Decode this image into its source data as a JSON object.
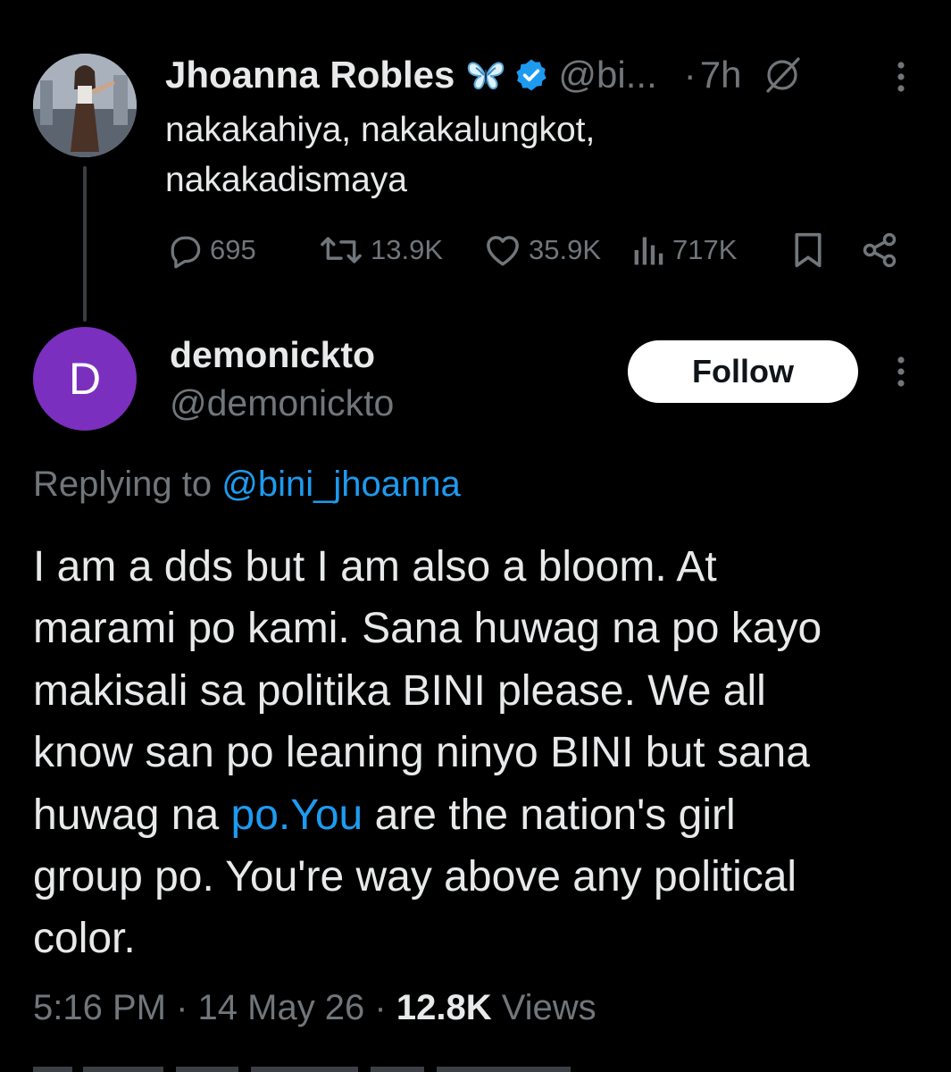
{
  "parent_tweet": {
    "name": "Jhoanna Robles",
    "badge_icon": "butterfly-icon",
    "handle": "@bi...",
    "separator": "·",
    "time": "7h",
    "text_lines": [
      "nakakahiya, nakakalungkot,",
      "nakakadismaya"
    ],
    "stats": {
      "replies": "695",
      "reposts": "13.9K",
      "likes": "35.9K",
      "views": "717K"
    }
  },
  "reply": {
    "avatar_letter": "D",
    "name": "demonickto",
    "handle": "@demonickto",
    "follow_label": "Follow",
    "replying_prefix": "Replying to ",
    "replying_mention": "@bini_jhoanna",
    "text_lines": [
      "I am a dds but I am also a bloom. At",
      "marami po kami. Sana huwag na po kayo",
      "makisali sa politika BINI please. We all",
      "know san po leaning ninyo BINI but sana"
    ],
    "line5_before": "huwag na ",
    "line5_link": "po.You",
    "line5_after": " are the nation's girl",
    "text_lines_end": [
      "group po. You're way above any political",
      "color."
    ],
    "timestamp": "5:16 PM",
    "separator": " · ",
    "date": "14 May 26",
    "views_count": "12.8K",
    "views_label": " Views"
  },
  "colors": {
    "background": "#000000",
    "text": "#e7e9ea",
    "muted": "#71767b",
    "link": "#1d9bf0",
    "avatar_purple": "#7b2fbe"
  }
}
